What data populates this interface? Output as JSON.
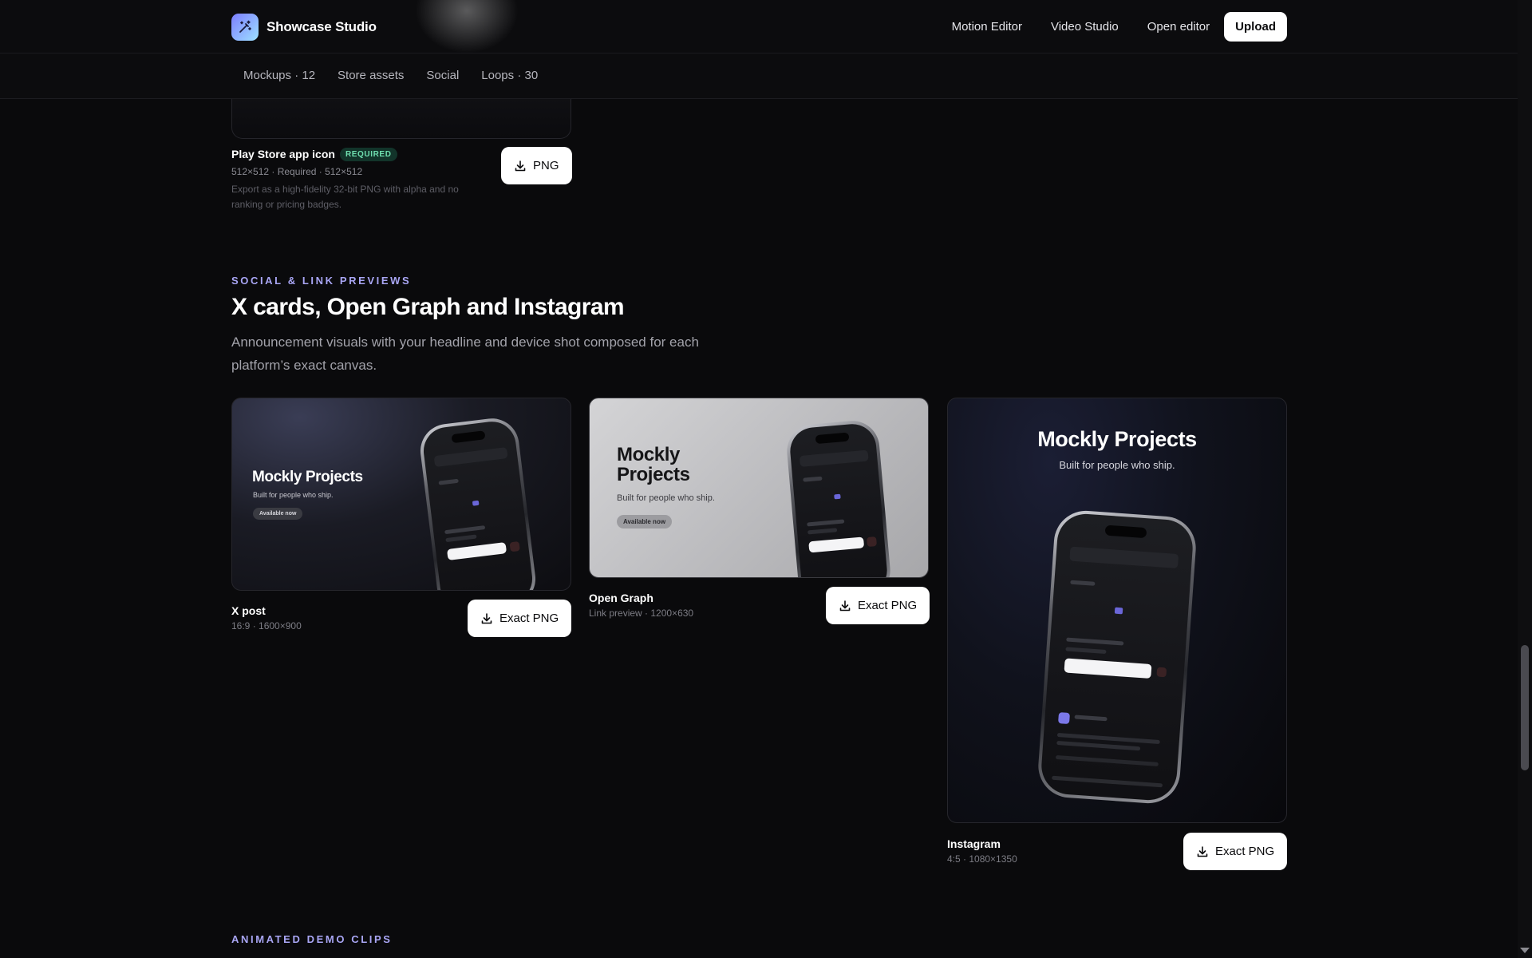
{
  "brand": {
    "name": "Showcase Studio",
    "logo_icon": "magic-wand-icon",
    "logo_gradient": [
      "#7b7dff",
      "#9ee2ff"
    ]
  },
  "nav": {
    "links": [
      "Motion Editor",
      "Video Studio",
      "Open editor"
    ],
    "upload_label": "Upload"
  },
  "tabs": [
    "Mockups · 12",
    "Store assets",
    "Social",
    "Loops · 30"
  ],
  "previous_asset": {
    "title": "Play Store app icon",
    "badge": "REQUIRED",
    "meta": "512×512 · Required · 512×512",
    "description": "Export as a high-fidelity 32-bit PNG with alpha and no ranking or pricing badges.",
    "button_label": "PNG"
  },
  "section": {
    "eyebrow": "SOCIAL & LINK PREVIEWS",
    "title": "X cards, Open Graph and Instagram",
    "subtitle": "Announcement visuals with your headline and device shot composed for each platform’s exact canvas."
  },
  "mock_content": {
    "headline": "Mockly Projects",
    "tagline": "Built for people who ship.",
    "pill": "Available now"
  },
  "cards": [
    {
      "name": "X post",
      "meta": "16:9 · 1600×900",
      "button_label": "Exact PNG"
    },
    {
      "name": "Open Graph",
      "meta": "Link preview · 1200×630",
      "button_label": "Exact PNG"
    },
    {
      "name": "Instagram",
      "meta": "4:5 · 1080×1350",
      "button_label": "Exact PNG"
    }
  ],
  "next_section": {
    "eyebrow": "ANIMATED DEMO CLIPS"
  },
  "colors": {
    "accent": "#a9a6f5",
    "background": "#0a0a0c",
    "badge_green": "#6fe0b0"
  }
}
